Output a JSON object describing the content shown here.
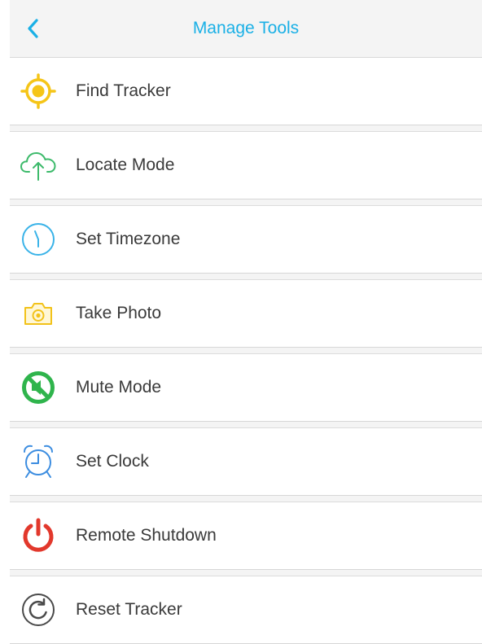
{
  "header": {
    "title": "Manage Tools",
    "back_icon": "chevron-left-icon"
  },
  "colors": {
    "accent": "#1ab0e6",
    "find": "#f5c518",
    "locate": "#3dba6b",
    "timezone": "#3ab3e8",
    "photo": "#f2c21a",
    "mute": "#2fb44c",
    "clock": "#3c8de0",
    "shutdown": "#e2382c",
    "reset": "#4a4a4a"
  },
  "tools": [
    {
      "label": "Find Tracker",
      "icon": "target-icon"
    },
    {
      "label": "Locate Mode",
      "icon": "cloud-upload-icon"
    },
    {
      "label": "Set Timezone",
      "icon": "clock-icon"
    },
    {
      "label": "Take Photo",
      "icon": "camera-icon"
    },
    {
      "label": "Mute Mode",
      "icon": "mute-icon"
    },
    {
      "label": "Set Clock",
      "icon": "alarm-clock-icon"
    },
    {
      "label": "Remote Shutdown",
      "icon": "power-icon"
    },
    {
      "label": "Reset Tracker",
      "icon": "reset-icon"
    }
  ]
}
